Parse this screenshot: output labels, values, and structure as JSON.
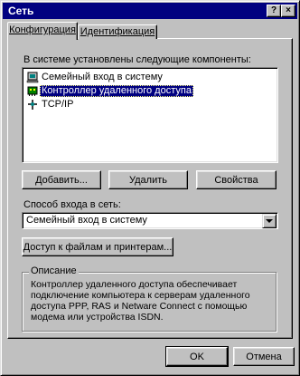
{
  "window": {
    "title": "Сеть",
    "help_glyph": "?",
    "close_glyph": "×"
  },
  "tabs": [
    {
      "label": "Конфигурация",
      "selected": true
    },
    {
      "label": "Идентификация",
      "selected": false
    }
  ],
  "components": {
    "label": "В системе установлены следующие компоненты:",
    "items": [
      {
        "label": "Семейный вход в систему",
        "icon": "client-icon",
        "selected": false
      },
      {
        "label": "Контроллер удаленного доступа",
        "icon": "adapter-icon",
        "selected": true
      },
      {
        "label": "TCP/IP",
        "icon": "protocol-icon",
        "selected": false
      }
    ]
  },
  "buttons": {
    "add": "Добавить...",
    "remove": "Удалить",
    "properties": "Свойства",
    "file_print_sharing": "Доступ к файлам и принтерам...",
    "ok": "OK",
    "cancel": "Отмена"
  },
  "logon": {
    "label": "Способ входа в сеть:",
    "value": "Семейный вход в систему"
  },
  "description": {
    "legend": "Описание",
    "text": "Контроллер удаленного доступа обеспечивает подключение компьютера к серверам удаленного доступа PPP, RAS и Netware Connect с помощью модема или устройства ISDN."
  },
  "colors": {
    "titlebar": "#000080",
    "face": "#c0c0c0",
    "selection": "#000080"
  }
}
